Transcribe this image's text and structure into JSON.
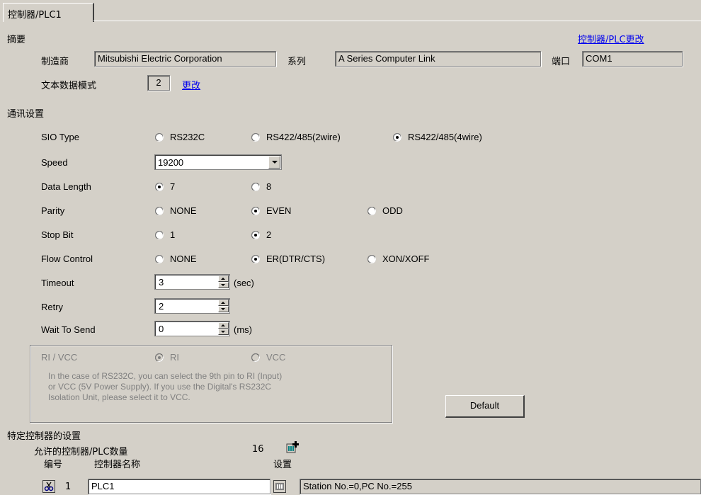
{
  "tab": {
    "label": "控制器/PLC1"
  },
  "summary": {
    "heading": "摘要",
    "change_link": "控制器/PLC更改",
    "manufacturer_label": "制造商",
    "manufacturer_value": "Mitsubishi Electric Corporation",
    "series_label": "系列",
    "series_value": "A Series Computer Link",
    "port_label": "端口",
    "port_value": "COM1",
    "text_mode_label": "文本数据模式",
    "text_mode_value": "2",
    "text_mode_change": "更改"
  },
  "comm": {
    "heading": "通讯设置",
    "sio_label": "SIO Type",
    "sio_options": [
      "RS232C",
      "RS422/485(2wire)",
      "RS422/485(4wire)"
    ],
    "speed_label": "Speed",
    "speed_value": "19200",
    "data_length_label": "Data Length",
    "data_length_options": [
      "7",
      "8"
    ],
    "parity_label": "Parity",
    "parity_options": [
      "NONE",
      "EVEN",
      "ODD"
    ],
    "stop_bit_label": "Stop Bit",
    "stop_bit_options": [
      "1",
      "2"
    ],
    "flow_label": "Flow Control",
    "flow_options": [
      "NONE",
      "ER(DTR/CTS)",
      "XON/XOFF"
    ],
    "timeout_label": "Timeout",
    "timeout_value": "3",
    "timeout_unit": "(sec)",
    "retry_label": "Retry",
    "retry_value": "2",
    "wait_label": "Wait To Send",
    "wait_value": "0",
    "wait_unit": "(ms)"
  },
  "rivcc": {
    "label": "RI / VCC",
    "options": [
      "RI",
      "VCC"
    ],
    "note_line1": "In the case of RS232C, you can select the 9th pin to RI (Input)",
    "note_line2": "or VCC (5V Power Supply). If you use the Digital's RS232C",
    "note_line3": "Isolation Unit, please select it to VCC."
  },
  "default_button": "Default",
  "specific": {
    "heading": "特定控制器的设置",
    "allowed_label": "允许的控制器/PLC数量",
    "allowed_value": "16",
    "col_number": "编号",
    "col_name": "控制器名称",
    "col_settings": "设置",
    "row_number": "1",
    "row_name": "PLC1",
    "row_settings": "Station No.=0,PC No.=255"
  }
}
